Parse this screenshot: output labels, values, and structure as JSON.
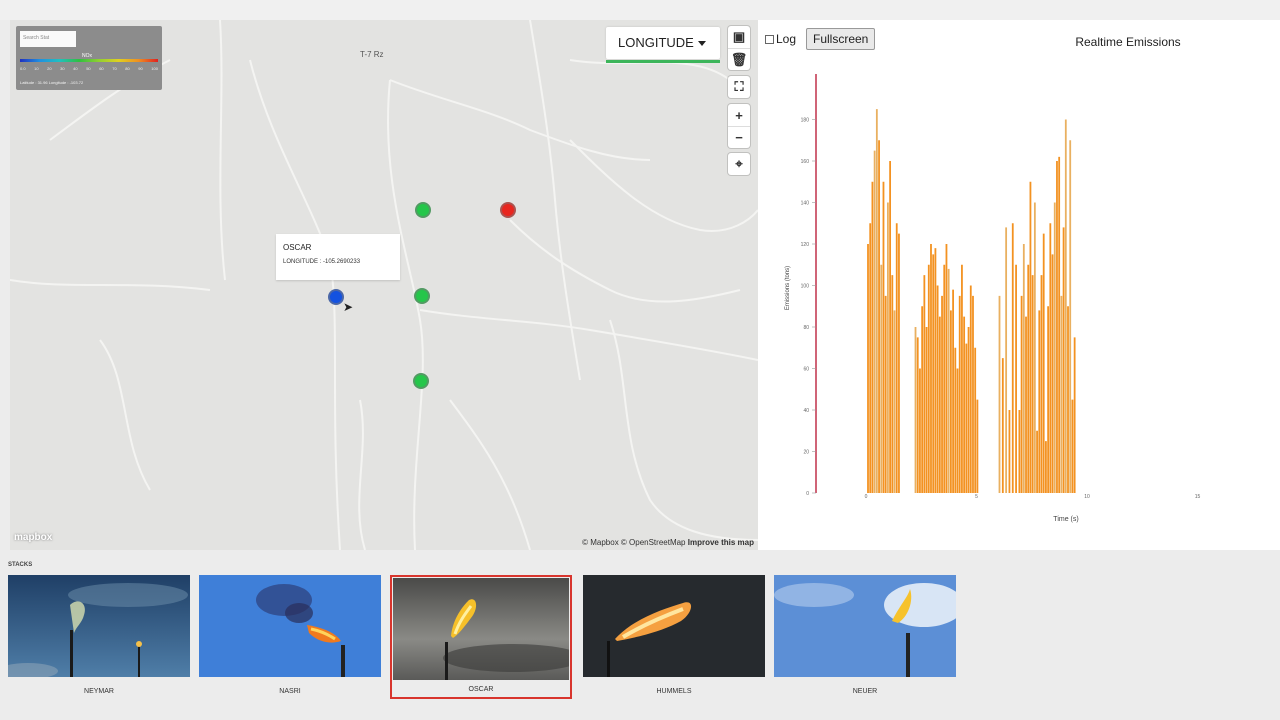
{
  "map": {
    "legend_search_text": "Search Stat",
    "legend_bar_label": "NOx",
    "legend_ticks": [
      "0.0",
      "10",
      "20",
      "30",
      "40",
      "50",
      "60",
      "70",
      "80",
      "90",
      "100"
    ],
    "legend_coords": "Latitude : 31.96   Longitude : -103.72",
    "place_label": "T-7 Rz",
    "metric_label": "LONGITUDE",
    "popup": {
      "name": "OSCAR",
      "value": "LONGITUDE : -105.2690233"
    },
    "controls": {
      "polygon_icon": "▣",
      "trash_icon": "🗑",
      "fullscreen_icon": "⛶",
      "zoom_in": "+",
      "zoom_out": "−",
      "locate_icon": "⌖"
    },
    "logo_text": "mapbox",
    "attribution": "© Mapbox © OpenStreetMap",
    "attribution_link": "Improve this map",
    "marker_colors": {
      "green": "#25c64a",
      "red": "#e8261f",
      "blue": "#1452e0"
    }
  },
  "chart_panel": {
    "log_label": "Log",
    "fullscreen_label": "Fullscreen",
    "title": "Realtime Emissions"
  },
  "chart_data": {
    "type": "bar",
    "title": "Realtime Emissions",
    "xlabel": "Time (s)",
    "ylabel": "Emissions (tons)",
    "xlim": [
      0,
      20
    ],
    "ylim": [
      0,
      200
    ],
    "x_ticks": [
      "0",
      "5",
      "10",
      "15",
      "20"
    ],
    "y_ticks": [
      "0",
      "20",
      "40",
      "60",
      "80",
      "100",
      "120",
      "140",
      "160",
      "180"
    ],
    "bar_color": "#f39221",
    "faded_bar_color": "#e9b060",
    "x": [
      0.05,
      0.15,
      0.25,
      0.35,
      0.45,
      0.55,
      0.65,
      0.75,
      0.85,
      0.95,
      1.05,
      1.15,
      1.25,
      1.35,
      1.45,
      2.2,
      2.3,
      2.4,
      2.5,
      2.6,
      2.7,
      2.8,
      2.9,
      3.0,
      3.1,
      3.2,
      3.3,
      3.4,
      3.5,
      3.6,
      3.7,
      3.8,
      3.9,
      4.0,
      4.1,
      4.2,
      4.3,
      4.4,
      4.5,
      4.6,
      4.7,
      4.8,
      4.9,
      5.0,
      6.0,
      6.15,
      6.3,
      6.45,
      6.6,
      6.75,
      6.9,
      7.0,
      7.1,
      7.2,
      7.3,
      7.4,
      7.5,
      7.6,
      7.7,
      7.8,
      7.9,
      8.0,
      8.1,
      8.2,
      8.3,
      8.4,
      8.5,
      8.6,
      8.7,
      8.8,
      8.9,
      9.0,
      9.1,
      9.2,
      9.3,
      9.4
    ],
    "values": [
      120,
      130,
      150,
      165,
      185,
      170,
      110,
      150,
      95,
      140,
      160,
      105,
      88,
      130,
      125,
      80,
      75,
      60,
      90,
      105,
      80,
      110,
      120,
      115,
      118,
      100,
      85,
      95,
      110,
      120,
      108,
      88,
      98,
      70,
      60,
      95,
      110,
      85,
      72,
      80,
      100,
      95,
      70,
      45,
      95,
      65,
      128,
      40,
      130,
      110,
      40,
      95,
      120,
      85,
      110,
      150,
      105,
      140,
      30,
      88,
      105,
      125,
      25,
      90,
      130,
      115,
      140,
      160,
      162,
      95,
      128,
      180,
      90,
      170,
      45,
      75
    ],
    "faded_indices": [
      3,
      4,
      6,
      9,
      12,
      15,
      30,
      44,
      46,
      52,
      57,
      66,
      69,
      71,
      73
    ]
  },
  "stacks": {
    "label": "STACKS",
    "items": [
      {
        "name": "NEYMAR",
        "selected": false
      },
      {
        "name": "NASRI",
        "selected": false
      },
      {
        "name": "OSCAR",
        "selected": true
      },
      {
        "name": "HUMMELS",
        "selected": false
      },
      {
        "name": "NEUER",
        "selected": false
      }
    ]
  }
}
